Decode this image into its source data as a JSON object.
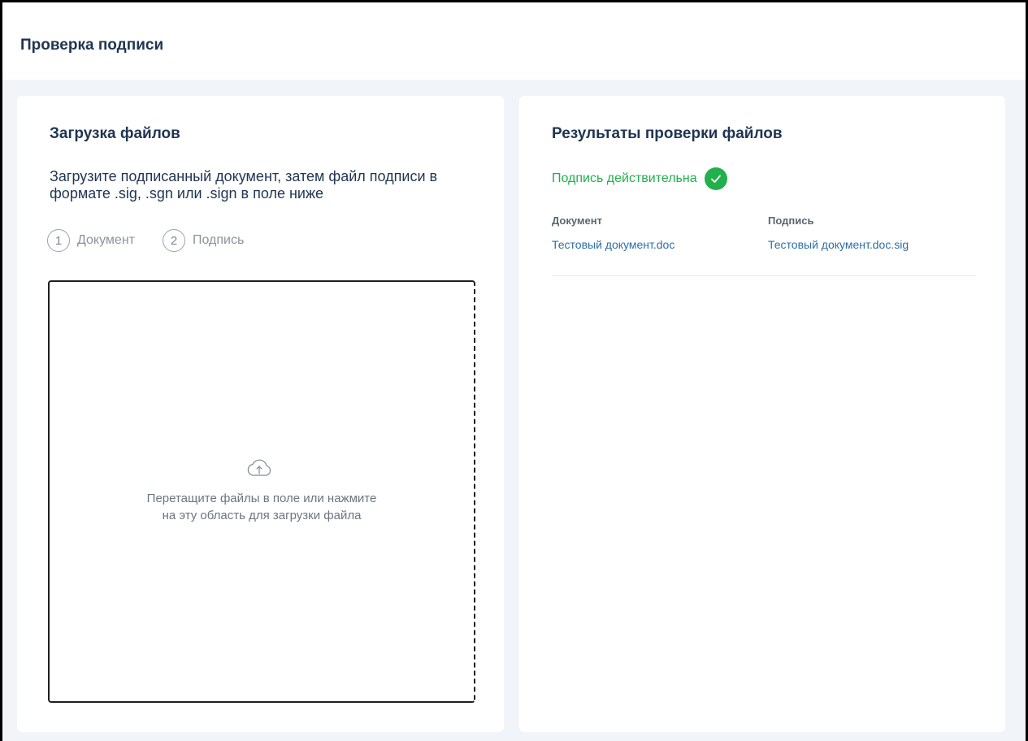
{
  "header": {
    "title": "Проверка подписи"
  },
  "upload": {
    "title": "Загрузка файлов",
    "description": "Загрузите подписанный документ, затем файл подписи в формате .sig, .sgn или .sign в поле ниже",
    "steps": [
      {
        "number": "1",
        "label": "Документ"
      },
      {
        "number": "2",
        "label": "Подпись"
      }
    ],
    "dropzone": {
      "icon": "cloud-upload-icon",
      "line1": "Перетащите файлы в поле или нажмите",
      "line2": "на эту область для загрузки файла"
    }
  },
  "results": {
    "title": "Результаты проверки файлов",
    "status": {
      "text": "Подпись действительна",
      "icon": "check-circle-icon",
      "color": "#21b04b"
    },
    "columns": {
      "document": {
        "header": "Документ",
        "file": "Тестовый документ.doc"
      },
      "signature": {
        "header": "Подпись",
        "file": "Тестовый документ.doc.sig"
      }
    }
  },
  "colors": {
    "heading": "#1f3552",
    "link": "#2c6ea6",
    "background": "#f1f4f8",
    "success": "#21b04b"
  }
}
